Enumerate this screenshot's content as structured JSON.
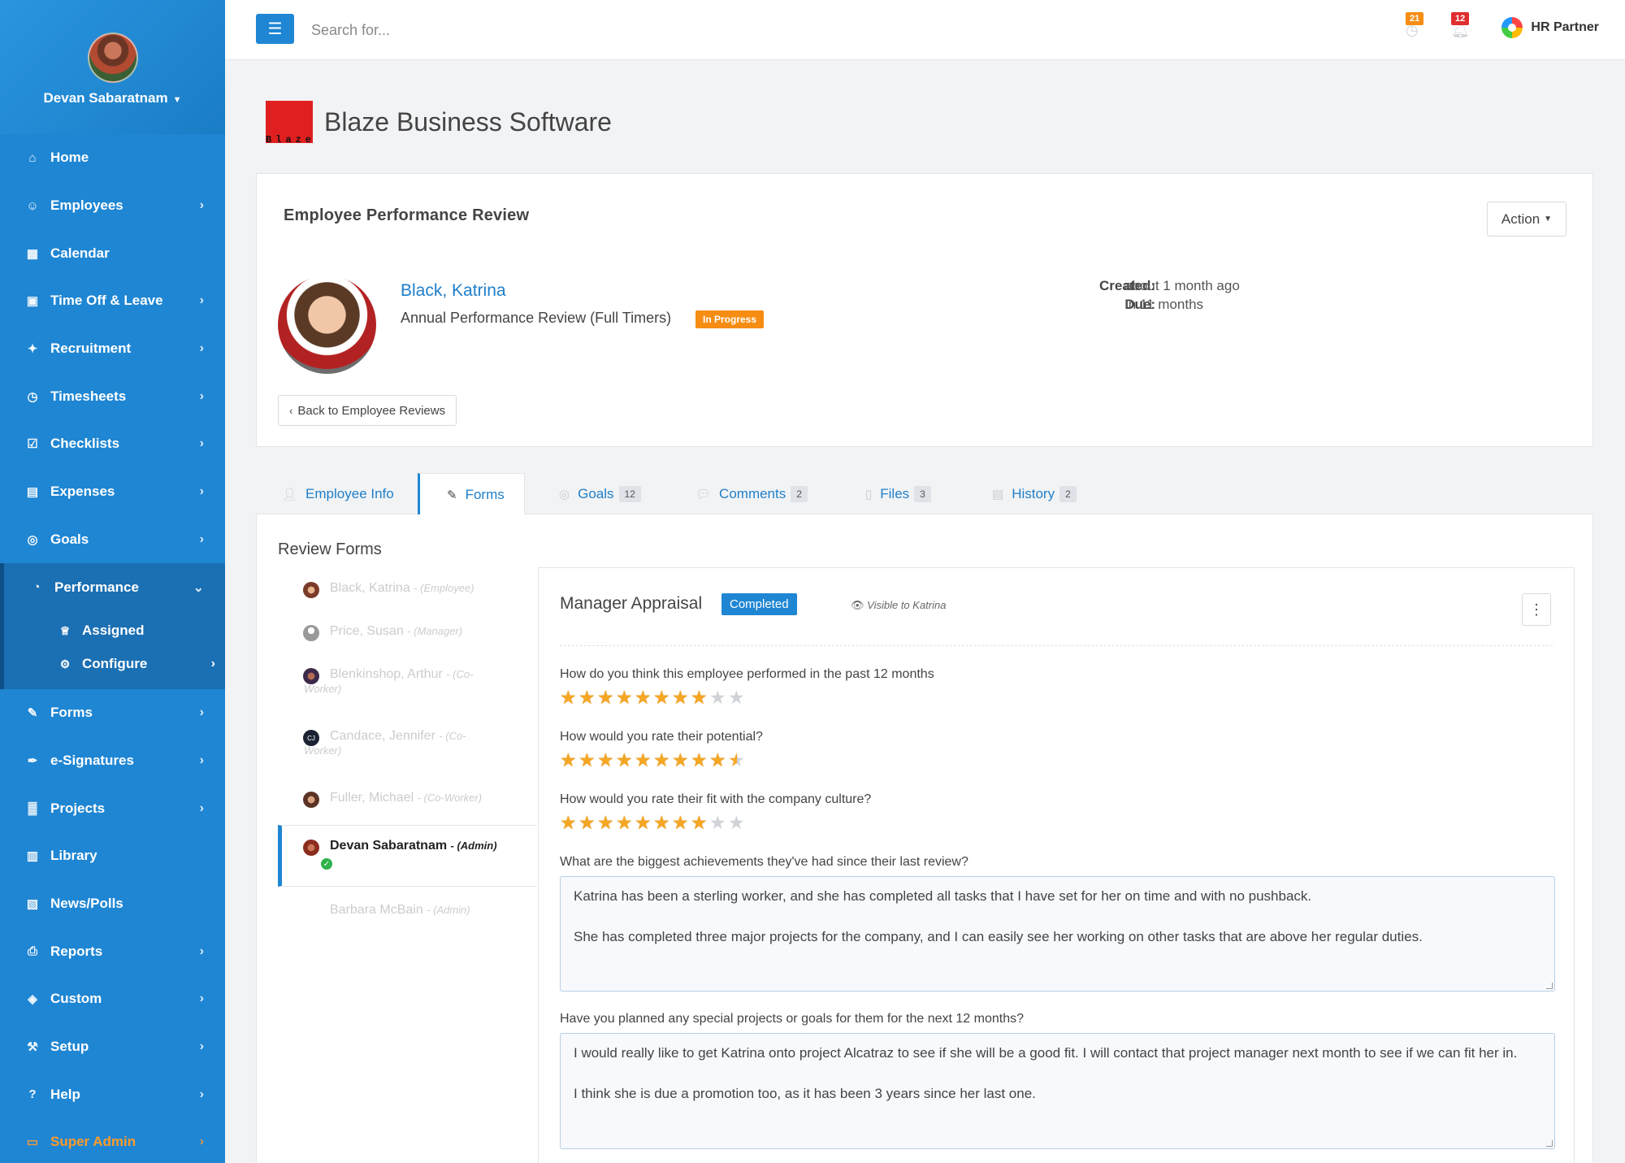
{
  "user": {
    "name": "Devan Sabaratnam"
  },
  "sidebar": {
    "items": [
      {
        "label": "Home",
        "icon": "home-icon",
        "glyph": "⌂"
      },
      {
        "label": "Employees",
        "icon": "users-icon",
        "glyph": "☺"
      },
      {
        "label": "Calendar",
        "icon": "calendar-icon",
        "glyph": "▦"
      },
      {
        "label": "Time Off & Leave",
        "icon": "suitcase-icon",
        "glyph": "▣"
      },
      {
        "label": "Recruitment",
        "icon": "handshake-icon",
        "glyph": "✦"
      },
      {
        "label": "Timesheets",
        "icon": "clock-icon",
        "glyph": "◷"
      },
      {
        "label": "Checklists",
        "icon": "checkbox-icon",
        "glyph": "☑"
      },
      {
        "label": "Expenses",
        "icon": "money-icon",
        "glyph": "▤"
      },
      {
        "label": "Goals",
        "icon": "target-icon",
        "glyph": "◎"
      },
      {
        "label": "Performance",
        "icon": "dashboard-icon",
        "glyph": "◔"
      },
      {
        "label": "Forms",
        "icon": "edit-icon",
        "glyph": "✎"
      },
      {
        "label": "e-Signatures",
        "icon": "pen-icon",
        "glyph": "✒"
      },
      {
        "label": "Projects",
        "icon": "industry-icon",
        "glyph": "▓"
      },
      {
        "label": "Library",
        "icon": "book-icon",
        "glyph": "▥"
      },
      {
        "label": "News/Polls",
        "icon": "newspaper-icon",
        "glyph": "▧"
      },
      {
        "label": "Reports",
        "icon": "print-icon",
        "glyph": "⎙"
      },
      {
        "label": "Custom",
        "icon": "cube-icon",
        "glyph": "◈"
      },
      {
        "label": "Setup",
        "icon": "wrench-icon",
        "glyph": "⚒"
      },
      {
        "label": "Help",
        "icon": "question-icon",
        "glyph": "?"
      },
      {
        "label": "Super Admin",
        "icon": "desktop-icon",
        "glyph": "▭"
      }
    ],
    "performance_sub": [
      {
        "label": "Assigned",
        "icon": "trophy-icon",
        "glyph": "♕"
      },
      {
        "label": "Configure",
        "icon": "gear-icon",
        "glyph": "⚙"
      }
    ]
  },
  "topbar": {
    "search_placeholder": "Search for...",
    "notif_count_1": "21",
    "notif_count_2": "12",
    "brand": "HR Partner",
    "colors": {
      "notif_1": "#f68d12",
      "notif_2": "#e02d2d"
    }
  },
  "company": {
    "name": "Blaze Business Software",
    "logo_text": "Blaze"
  },
  "review": {
    "title": "Employee Performance Review",
    "action_label": "Action",
    "employee_name": "Black, Katrina",
    "review_name": "Annual Performance Review (Full Timers)",
    "status": "In Progress",
    "created_label": "Created:",
    "created_value": "about 1 month ago",
    "due_label": "Due:",
    "due_value": "In 11 months",
    "back_label": "Back to Employee Reviews"
  },
  "tabs": [
    {
      "label": "Employee Info",
      "count": ""
    },
    {
      "label": "Forms",
      "count": ""
    },
    {
      "label": "Goals",
      "count": "12"
    },
    {
      "label": "Comments",
      "count": "2"
    },
    {
      "label": "Files",
      "count": "3"
    },
    {
      "label": "History",
      "count": "2"
    }
  ],
  "forms": {
    "title": "Review Forms",
    "items": [
      {
        "name": "Black, Katrina",
        "role": "- (Employee)"
      },
      {
        "name": "Price, Susan",
        "role": "- (Manager)"
      },
      {
        "name": "Blenkinshop, Arthur",
        "role": "- (Co-",
        "role2": "Worker)"
      },
      {
        "name": "Candace, Jennifer",
        "role": "- (Co-",
        "role2": "Worker)",
        "initials": "CJ"
      },
      {
        "name": "Fuller, Michael",
        "role": "- (Co-Worker)"
      },
      {
        "name": "Devan Sabaratnam",
        "role": "- (Admin)"
      },
      {
        "name": "Barbara McBain",
        "role": "- (Admin)"
      }
    ]
  },
  "appraisal": {
    "title": "Manager Appraisal",
    "status": "Completed",
    "visible_to": "Visible to Katrina",
    "questions": [
      {
        "text": "How do you think this employee performed in the past 12 months",
        "rating": 8,
        "max": 10
      },
      {
        "text": "How would you rate their potential?",
        "rating": 9.5,
        "max": 10
      },
      {
        "text": "How would you rate their fit with the company culture?",
        "rating": 8,
        "max": 10
      }
    ],
    "q4": "What are the biggest achievements they've had since their last review?",
    "a4_p1": "Katrina has been a sterling worker, and she has completed all tasks that I have set for her on time and with no pushback.",
    "a4_p2": "She has completed three major projects for the company, and I can easily see her working on other tasks that are above her regular duties.",
    "q5": "Have you planned any special projects or goals for them for the next 12 months?",
    "a5_p1": "I would really like to get Katrina onto project Alcatraz to see if she will be a good fit.  I will contact that project manager next month to see if we can fit her in.",
    "a5_p2": "I think she is due a promotion too, as it has been 3 years since her last one."
  }
}
